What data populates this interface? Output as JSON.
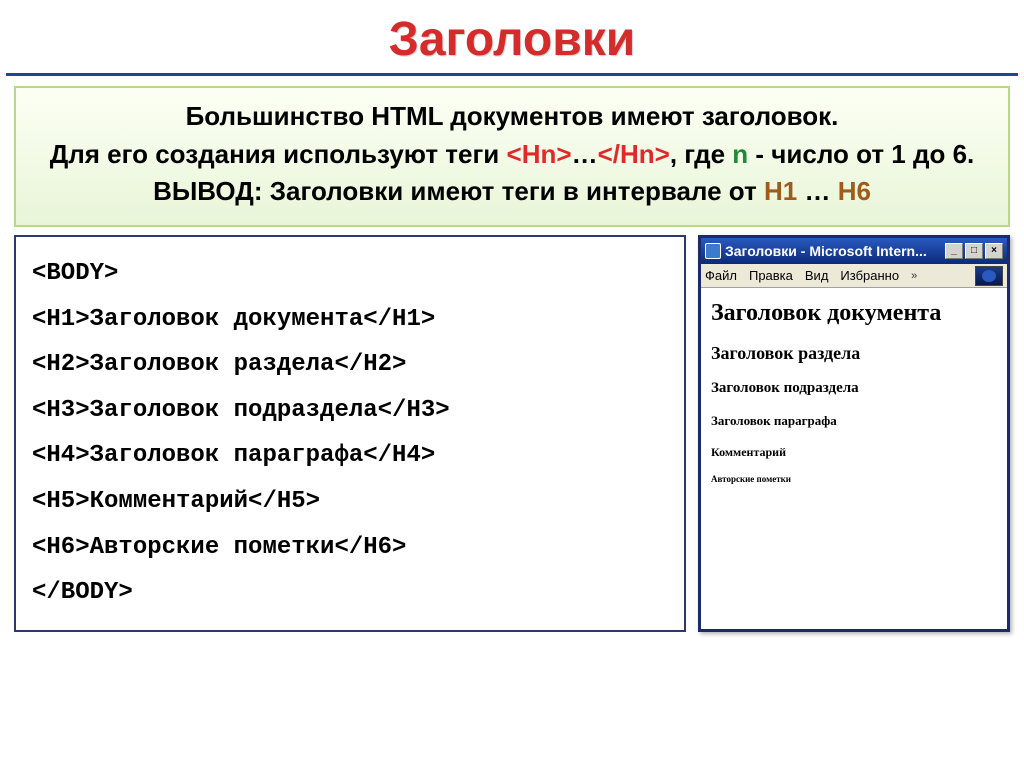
{
  "title": "Заголовки",
  "intro": {
    "line1": "Большинство HTML документов имеют заголовок.",
    "line2_pre": "Для его создания используют теги ",
    "tag_open": "<Hn>",
    "ellipsis": "…",
    "tag_close": "</Hn>",
    "line2_post1": ", где ",
    "n_text": "n",
    "line2_post2": " - число от 1 до 6.",
    "line3_pre": "ВЫВОД: Заголовки имеют теги в интервале от ",
    "h1": "H1",
    "dots": " … ",
    "h6": "H6"
  },
  "code": {
    "l0": "<BODY>",
    "l1": "<H1>Заголовок документа</H1>",
    "l2": "<H2>Заголовок раздела</H2>",
    "l3": "<H3>Заголовок подраздела</H3>",
    "l4": "<H4>Заголовок параграфа</H4>",
    "l5": "<H5>Комментарий</H5>",
    "l6": "<H6>Авторские пометки</H6>",
    "l7": "</BODY>"
  },
  "browser": {
    "title": "Заголовки - Microsoft Intern...",
    "menu": {
      "file": "Файл",
      "edit": "Правка",
      "view": "Вид",
      "fav": "Избранно"
    },
    "win": {
      "min": "_",
      "max": "□",
      "close": "×"
    },
    "render": {
      "h1": "Заголовок документа",
      "h2": "Заголовок раздела",
      "h3": "Заголовок подраздела",
      "h4": "Заголовок параграфа",
      "h5": "Комментарий",
      "h6": "Авторские пометки"
    }
  }
}
